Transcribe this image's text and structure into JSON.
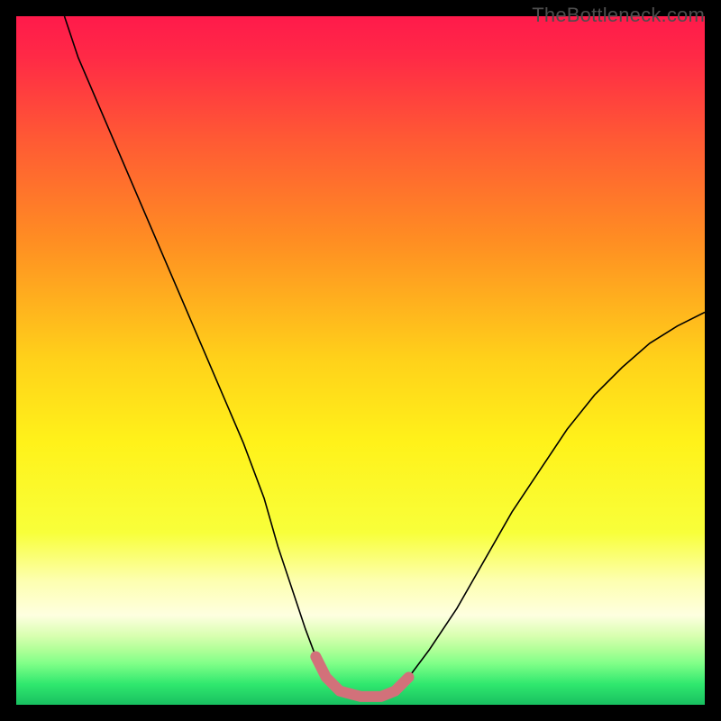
{
  "watermark": "TheBottleneck.com",
  "chart_data": {
    "type": "line",
    "title": "",
    "xlabel": "",
    "ylabel": "",
    "xlim": [
      0,
      100
    ],
    "ylim": [
      0,
      100
    ],
    "grid": false,
    "gradient_stops": [
      {
        "offset": 0.0,
        "color": "#ff1a4b"
      },
      {
        "offset": 0.06,
        "color": "#ff2a46"
      },
      {
        "offset": 0.18,
        "color": "#ff5a34"
      },
      {
        "offset": 0.33,
        "color": "#ff8f22"
      },
      {
        "offset": 0.5,
        "color": "#ffd21a"
      },
      {
        "offset": 0.62,
        "color": "#fff21a"
      },
      {
        "offset": 0.75,
        "color": "#f8ff3a"
      },
      {
        "offset": 0.82,
        "color": "#fdffb0"
      },
      {
        "offset": 0.87,
        "color": "#feffe0"
      },
      {
        "offset": 0.9,
        "color": "#d8ffb0"
      },
      {
        "offset": 0.92,
        "color": "#b0ff98"
      },
      {
        "offset": 0.94,
        "color": "#80ff88"
      },
      {
        "offset": 0.97,
        "color": "#30e86e"
      },
      {
        "offset": 1.0,
        "color": "#18c060"
      }
    ],
    "series": [
      {
        "name": "bottleneck-curve",
        "stroke": "#000000",
        "stroke_width": 1.6,
        "x": [
          7,
          9,
          12,
          15,
          18,
          21,
          24,
          27,
          30,
          33,
          36,
          38,
          40,
          42,
          43.5,
          45,
          47,
          50,
          53,
          55,
          57,
          60,
          64,
          68,
          72,
          76,
          80,
          84,
          88,
          92,
          96,
          100
        ],
        "y": [
          100,
          94,
          87,
          80,
          73,
          66,
          59,
          52,
          45,
          38,
          30,
          23,
          17,
          11,
          7,
          4,
          2,
          1.2,
          1.2,
          2,
          4,
          8,
          14,
          21,
          28,
          34,
          40,
          45,
          49,
          52.5,
          55,
          57
        ]
      },
      {
        "name": "optimal-band",
        "stroke": "#d2717a",
        "stroke_width": 12,
        "linecap": "round",
        "x": [
          43.5,
          45,
          47,
          50,
          53,
          55,
          57
        ],
        "y": [
          7,
          4,
          2,
          1.2,
          1.2,
          2,
          4
        ]
      }
    ]
  }
}
